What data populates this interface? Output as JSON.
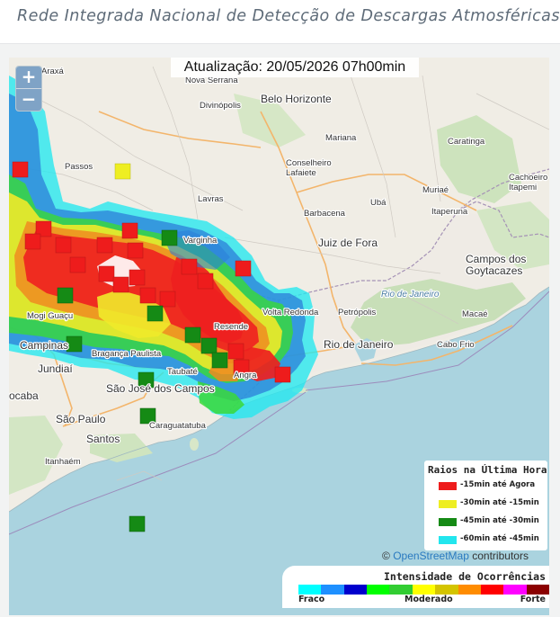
{
  "header": {
    "title": "Rede Integrada Nacional de Detecção de Descargas Atmosféricas"
  },
  "update": {
    "text": "Atualização: 20/05/2026 07h00min"
  },
  "zoom": {
    "in_label": "+",
    "out_label": "−"
  },
  "legend": {
    "title": "Raios na Última Hora",
    "items": [
      {
        "label": "-15min até Agora",
        "color": "#ee1c1c"
      },
      {
        "label": "-30min até -15min",
        "color": "#eeee22"
      },
      {
        "label": "-45min até -30min",
        "color": "#158a15"
      },
      {
        "label": "-60min até -45min",
        "color": "#22e6ee"
      }
    ]
  },
  "attribution": {
    "prefix": "©",
    "link": "OpenStreetMap",
    "suffix": "contributors"
  },
  "intensity": {
    "title": "Intensidade de Ocorrências",
    "low": "Fraco",
    "mid": "Moderado",
    "high": "Forte",
    "colors": [
      "#00ffff",
      "#1e90ff",
      "#0000cd",
      "#00ff00",
      "#32cd32",
      "#ffff00",
      "#d4c400",
      "#ff8c00",
      "#ff0000",
      "#ff00ff",
      "#8b0000"
    ]
  },
  "places": [
    {
      "name": "Araxá",
      "size": "s"
    },
    {
      "name": "Nova Serrana",
      "size": "s"
    },
    {
      "name": "Divinópolis",
      "size": "s"
    },
    {
      "name": "Belo Horizonte",
      "size": "l"
    },
    {
      "name": "Mariana",
      "size": "s"
    },
    {
      "name": "Passos",
      "size": "s"
    },
    {
      "name": "Conselheiro Lafaiete",
      "size": "s"
    },
    {
      "name": "Caratinga",
      "size": "s"
    },
    {
      "name": "Cachoeiro de Itapemi",
      "size": "s"
    },
    {
      "name": "Lavras",
      "size": "s"
    },
    {
      "name": "Barbacena",
      "size": "s"
    },
    {
      "name": "Muriaé",
      "size": "s"
    },
    {
      "name": "Ubá",
      "size": "s"
    },
    {
      "name": "Itaperuna",
      "size": "s"
    },
    {
      "name": "Varginha",
      "size": "s"
    },
    {
      "name": "Juiz de Fora",
      "size": "l"
    },
    {
      "name": "Campos dos Goytacazes",
      "size": "l"
    },
    {
      "name": "Rio de Janeiro",
      "size": "w"
    },
    {
      "name": "Volta Redonda",
      "size": "s"
    },
    {
      "name": "Petrópolis",
      "size": "s"
    },
    {
      "name": "Macaé",
      "size": "s"
    },
    {
      "name": "Mogi Guaçu",
      "size": "s"
    },
    {
      "name": "Campinas",
      "size": "l"
    },
    {
      "name": "Rio de Janeiro",
      "size": "l"
    },
    {
      "name": "Cabo Frio",
      "size": "s"
    },
    {
      "name": "Bragança Paulista",
      "size": "s"
    },
    {
      "name": "Jundiaí",
      "size": "l"
    },
    {
      "name": "Taubaté",
      "size": "s"
    },
    {
      "name": "São José dos Campos",
      "size": "l"
    },
    {
      "name": "São Paulo",
      "size": "l"
    },
    {
      "name": "Caraguatatuba",
      "size": "s"
    },
    {
      "name": "Santos",
      "size": "l"
    },
    {
      "name": "Itanhaém",
      "size": "s"
    },
    {
      "name": "ocaba",
      "size": "l"
    },
    {
      "name": "Angra",
      "size": "s"
    },
    {
      "name": "Resende",
      "size": "s"
    }
  ]
}
